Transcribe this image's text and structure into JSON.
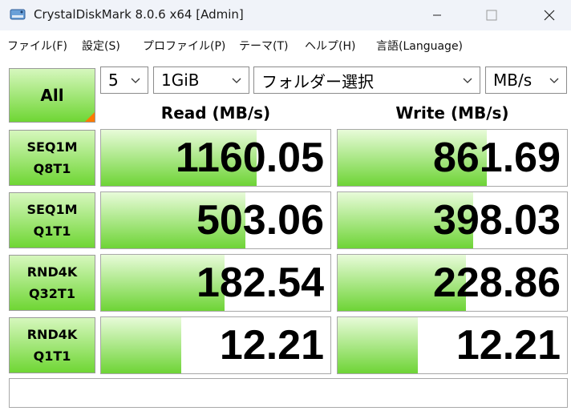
{
  "window": {
    "title": "CrystalDiskMark 8.0.6 x64 [Admin]",
    "controls": {
      "minimize": "minimize",
      "maximize": "maximize",
      "close": "close"
    }
  },
  "menu": [
    {
      "label": "ファイル(F)"
    },
    {
      "label": "設定(S)"
    },
    {
      "label": "プロファイル(P)"
    },
    {
      "label": "テーマ(T)"
    },
    {
      "label": "ヘルプ(H)"
    },
    {
      "label": "言語(Language)"
    }
  ],
  "controls": {
    "all_label": "All",
    "count": "5",
    "size": "1GiB",
    "folder": "フォルダー選択",
    "unit": "MB/s"
  },
  "headers": {
    "read": "Read (MB/s)",
    "write": "Write (MB/s)"
  },
  "tests": [
    {
      "line1": "SEQ1M",
      "line2": "Q8T1",
      "read": "1160.05",
      "write": "861.69",
      "read_fill": 0.68,
      "write_fill": 0.65
    },
    {
      "line1": "SEQ1M",
      "line2": "Q1T1",
      "read": "503.06",
      "write": "398.03",
      "read_fill": 0.63,
      "write_fill": 0.59
    },
    {
      "line1": "RND4K",
      "line2": "Q32T1",
      "read": "182.54",
      "write": "228.86",
      "read_fill": 0.54,
      "write_fill": 0.56
    },
    {
      "line1": "RND4K",
      "line2": "Q1T1",
      "read": "12.21",
      "write": "12.21",
      "read_fill": 0.35,
      "write_fill": 0.35
    }
  ],
  "comment": "",
  "colors": {
    "accent_green": "#6fd634",
    "corner": "#ff7a00"
  }
}
